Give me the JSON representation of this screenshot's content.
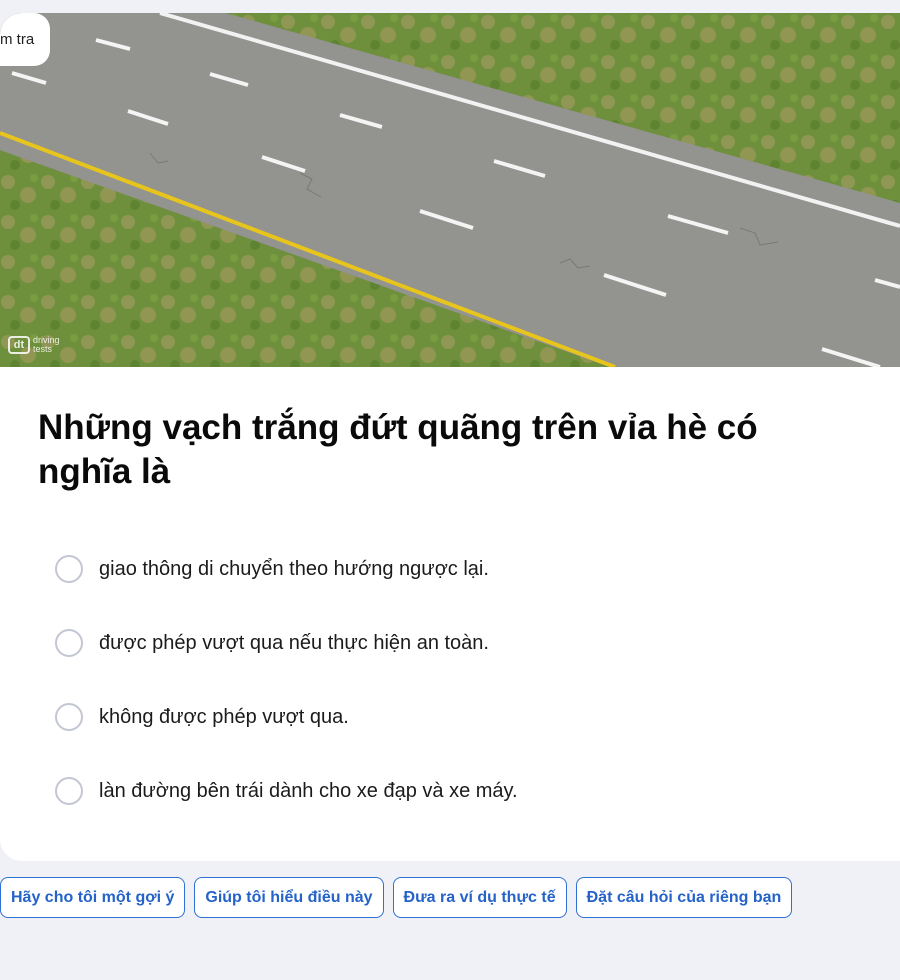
{
  "card": {
    "tag_label": "m tra",
    "watermark": "driving tests",
    "watermark_logo": "dt",
    "question": "Những vạch trắng đứt quãng trên vỉa hè có nghĩa là"
  },
  "options": [
    {
      "label": "giao thông di chuyển theo hướng ngược lại."
    },
    {
      "label": "được phép vượt qua nếu thực hiện an toàn."
    },
    {
      "label": "không được phép vượt qua."
    },
    {
      "label": "làn đường bên trái dành cho xe đạp và xe máy."
    }
  ],
  "actions": [
    {
      "label": "Hãy cho tôi một gợi ý"
    },
    {
      "label": "Giúp tôi hiểu điều này"
    },
    {
      "label": "Đưa ra ví dụ thực tế"
    },
    {
      "label": "Đặt câu hỏi của riêng bạn"
    }
  ],
  "colors": {
    "accent": "#2563c9",
    "background": "#f0f1f6",
    "road": "#8e8f8c",
    "grass": "#6f8f3a",
    "yellow_line": "#e8c51c"
  }
}
